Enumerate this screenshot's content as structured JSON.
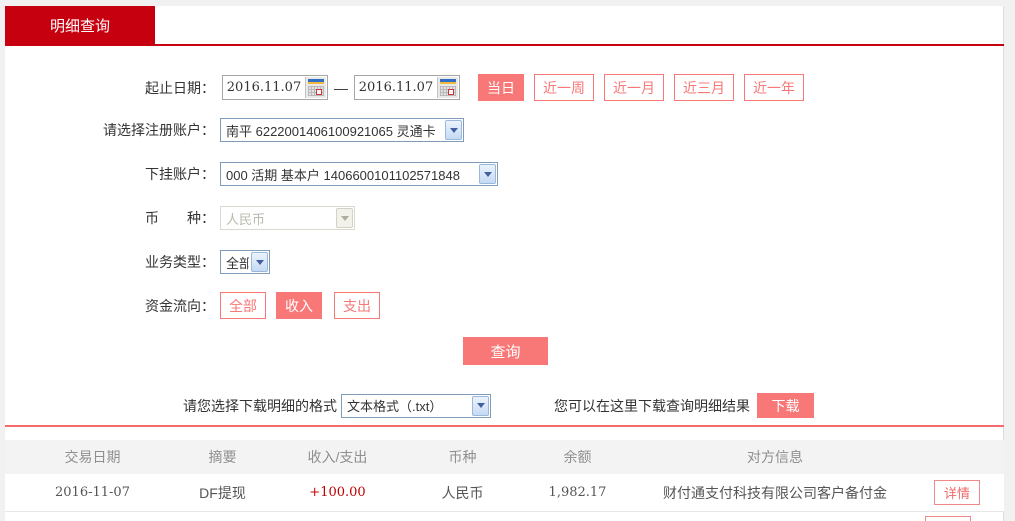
{
  "tab": {
    "label": "明细查询"
  },
  "form": {
    "date_range": {
      "label": "起止日期：",
      "start_value": "2016.11.07",
      "end_value": "2016.11.07",
      "separator": "—"
    },
    "quick_buttons": [
      {
        "label": "当日",
        "active": true
      },
      {
        "label": "近一周",
        "active": false
      },
      {
        "label": "近一月",
        "active": false
      },
      {
        "label": "近三月",
        "active": false
      },
      {
        "label": "近一年",
        "active": false
      }
    ],
    "register_account": {
      "label": "请选择注册账户：",
      "value": "南平 6222001406100921065 灵通卡"
    },
    "sub_account": {
      "label": "下挂账户：",
      "value": "000 活期 基本户 1406600101102571848"
    },
    "currency": {
      "label": "币　　种：",
      "value": "人民币",
      "disabled": true
    },
    "business_type": {
      "label": "业务类型：",
      "value": "全部"
    },
    "fund_flow": {
      "label": "资金流向：",
      "options": [
        {
          "label": "全部",
          "active": false
        },
        {
          "label": "收入",
          "active": true
        },
        {
          "label": "支出",
          "active": false
        }
      ]
    },
    "query_button": "查询",
    "download": {
      "format_label": "请您选择下载明细的格式",
      "format_value": "文本格式（.txt）",
      "hint": "您可以在这里下载查询明细结果",
      "button": "下载"
    }
  },
  "table": {
    "headers": [
      "交易日期",
      "摘要",
      "收入/支出",
      "币种",
      "余额",
      "对方信息"
    ],
    "rows": [
      {
        "date": "2016-11-07",
        "summary": "DF提现",
        "amount": "+100.00",
        "currency": "人民币",
        "balance": "1,982.17",
        "counterparty": "财付通支付科技有限公司客户备付金",
        "action": "详情"
      }
    ]
  },
  "icons": {
    "calendar": "calendar-icon",
    "chevron": "chevron-down-icon"
  },
  "colors": {
    "tab_red": "#c70010",
    "button_salmon": "#f87878",
    "divider_salmon": "#f56b6b",
    "amount_red": "#c00000",
    "header_gray_bg": "#f3f3f3"
  }
}
